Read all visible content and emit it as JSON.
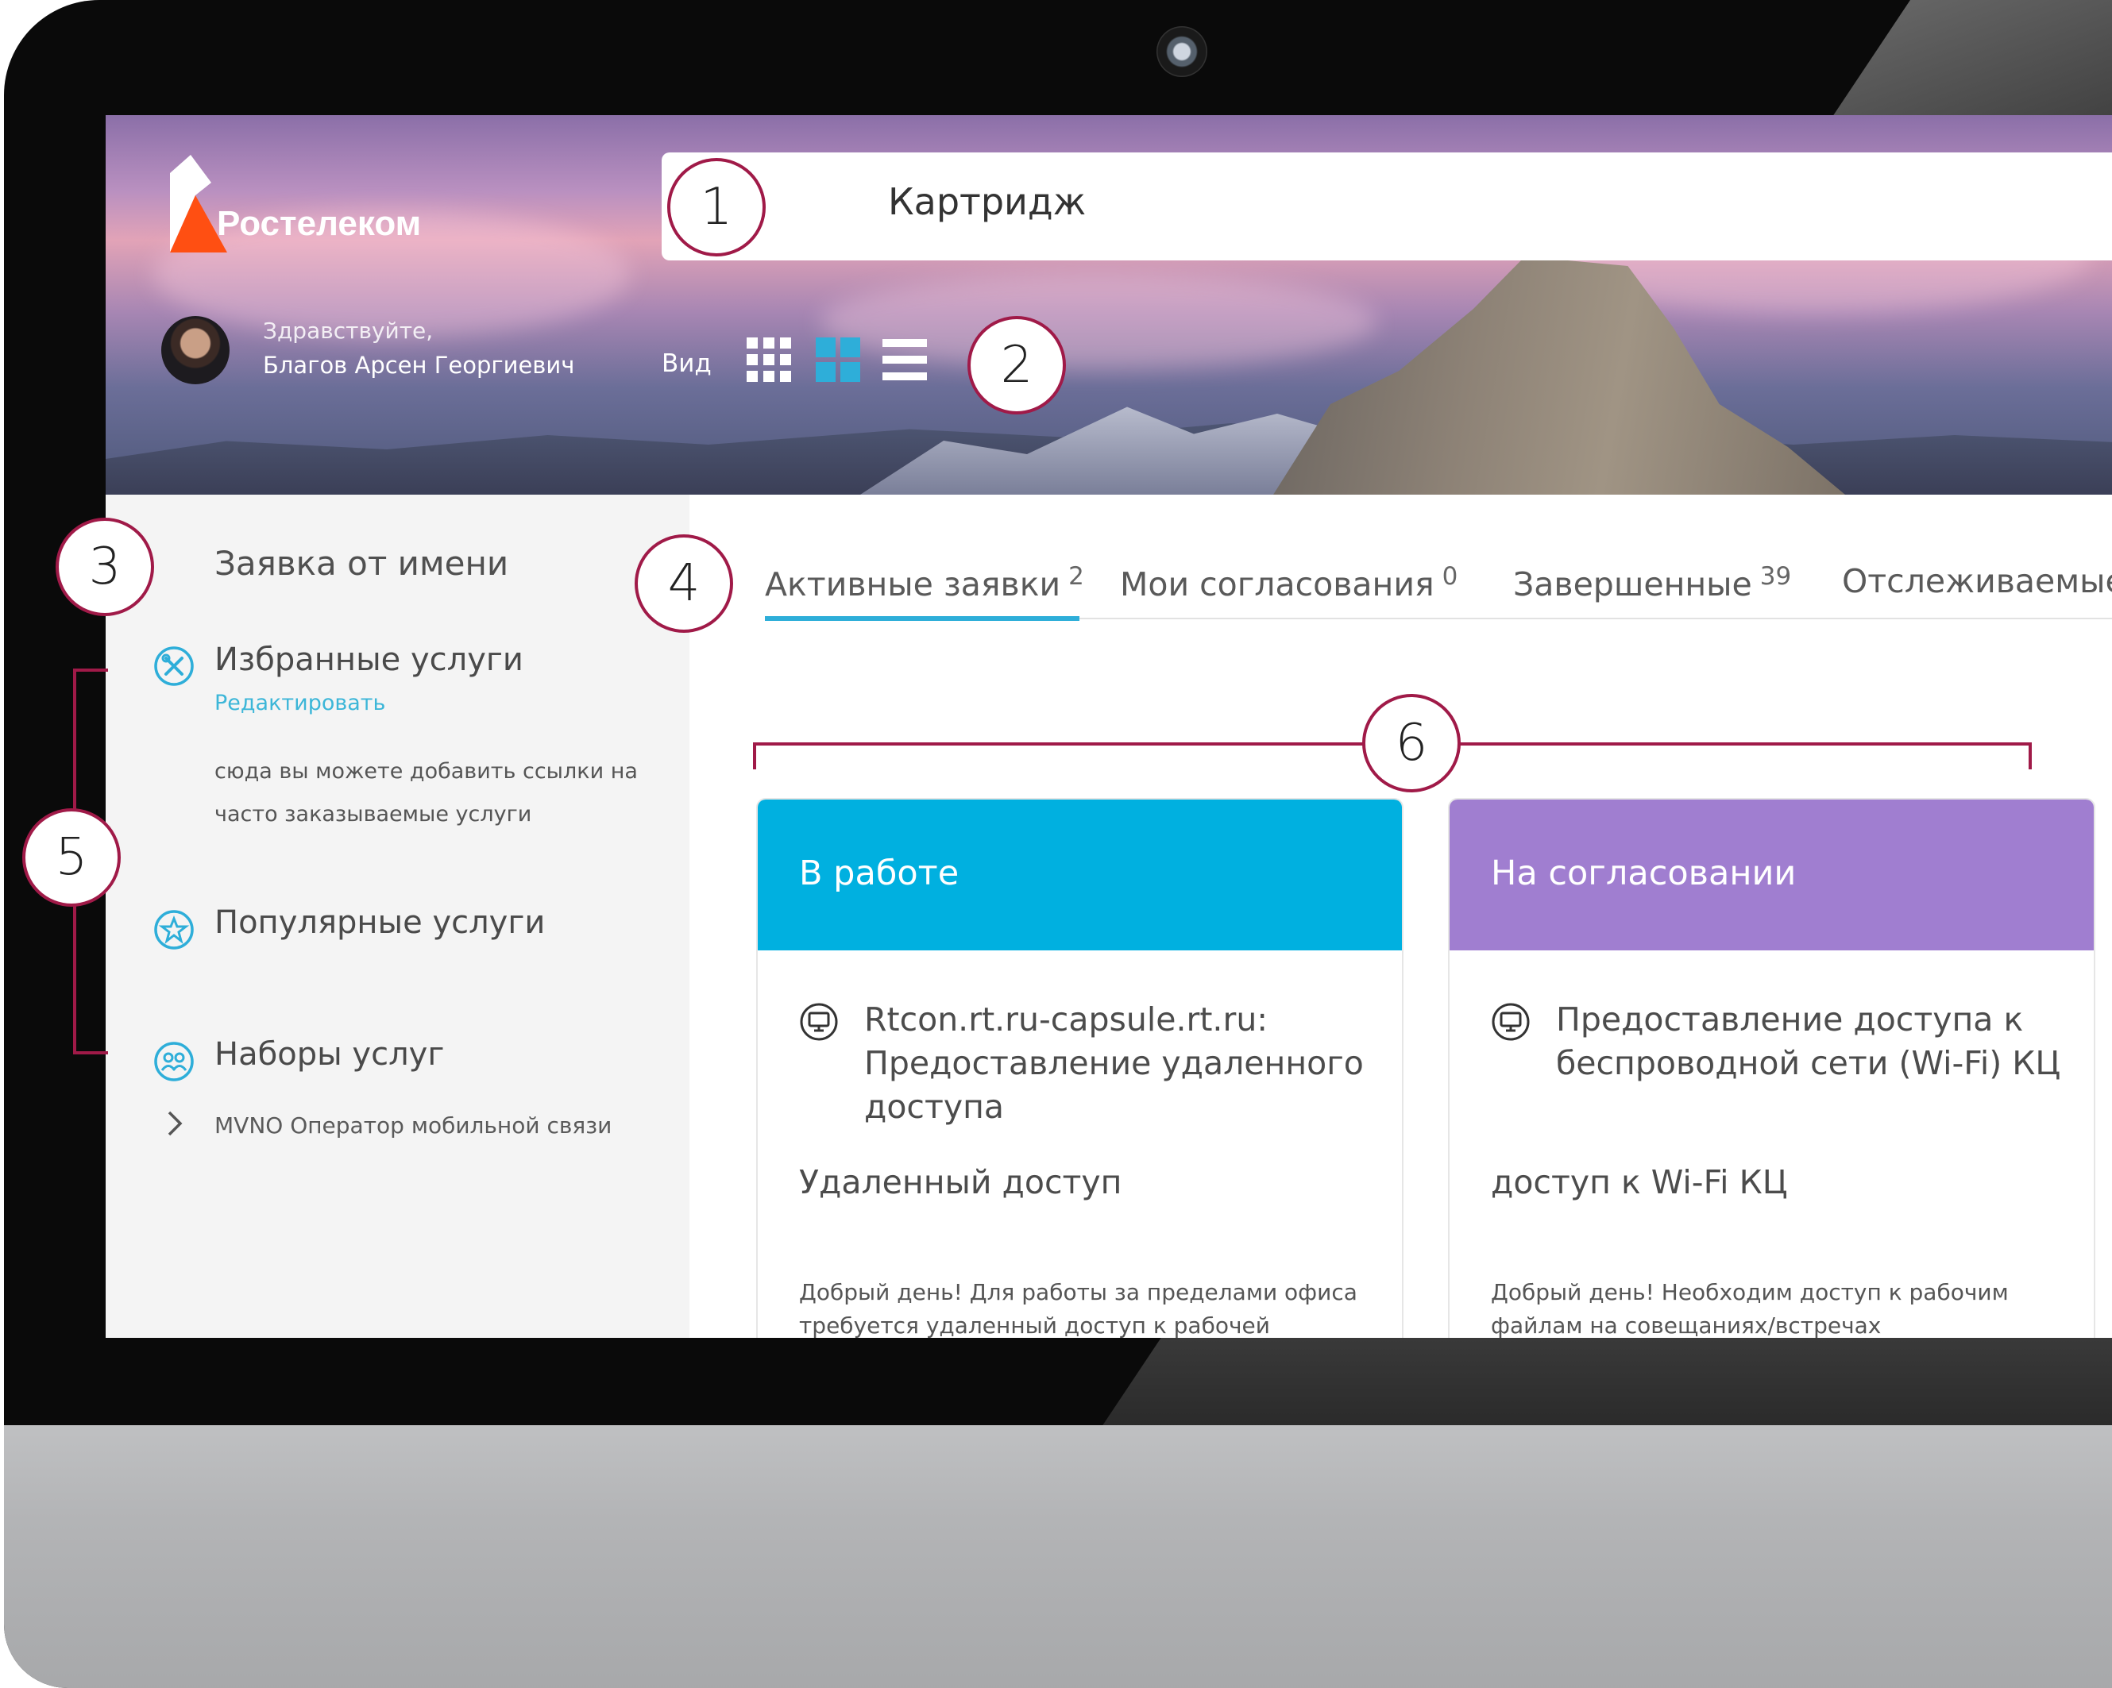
{
  "brand": {
    "name": "Ростелеком"
  },
  "search": {
    "value": "Картридж"
  },
  "user": {
    "greeting": "Здравствуйте,",
    "name": "Благов Арсен Георгиевич"
  },
  "view": {
    "label": "Вид",
    "modes": [
      "grid-small-icon",
      "grid-large-icon",
      "list-icon"
    ],
    "active": "grid-large-icon"
  },
  "sidebar": {
    "title": "Заявка от имени",
    "favorites": {
      "title": "Избранные услуги",
      "edit": "Редактировать",
      "note_line1": "сюда вы можете добавить ссылки на",
      "note_line2": "часто заказываемые услуги"
    },
    "popular": {
      "title": "Популярные услуги"
    },
    "sets": {
      "title": "Наборы услуг",
      "items": [
        "MVNO Оператор мобильной связи"
      ]
    }
  },
  "tabs": [
    {
      "label": "Активные заявки",
      "count": "2"
    },
    {
      "label": "Мои согласования",
      "count": "0"
    },
    {
      "label": "Завершенные",
      "count": "39"
    },
    {
      "label": "Отслеживаемые",
      "count": ""
    }
  ],
  "cards": [
    {
      "status": "В работе",
      "color": "#00b0e0",
      "title": "Rtcon.rt.ru-capsule.rt.ru: Предоставление удаленного доступа",
      "subtitle": "Удаленный доступ",
      "description": "Добрый день! Для работы за пределами офиса требуется удаленный доступ к рабочей станции"
    },
    {
      "status": "На согласовании",
      "color": "#a07ed0",
      "title": "Предоставление доступа к беспроводной сети (Wi-Fi) КЦ",
      "subtitle": "доступ к Wi-Fi КЦ",
      "description": "Добрый день! Необходим доступ к рабочим файлам на совещаниях/встречах"
    }
  ],
  "annotations": [
    "1",
    "2",
    "3",
    "4",
    "5",
    "6"
  ],
  "colors": {
    "accent": "#2eaed9",
    "annotation": "#a01a48",
    "brand_orange": "#ff4f12"
  }
}
